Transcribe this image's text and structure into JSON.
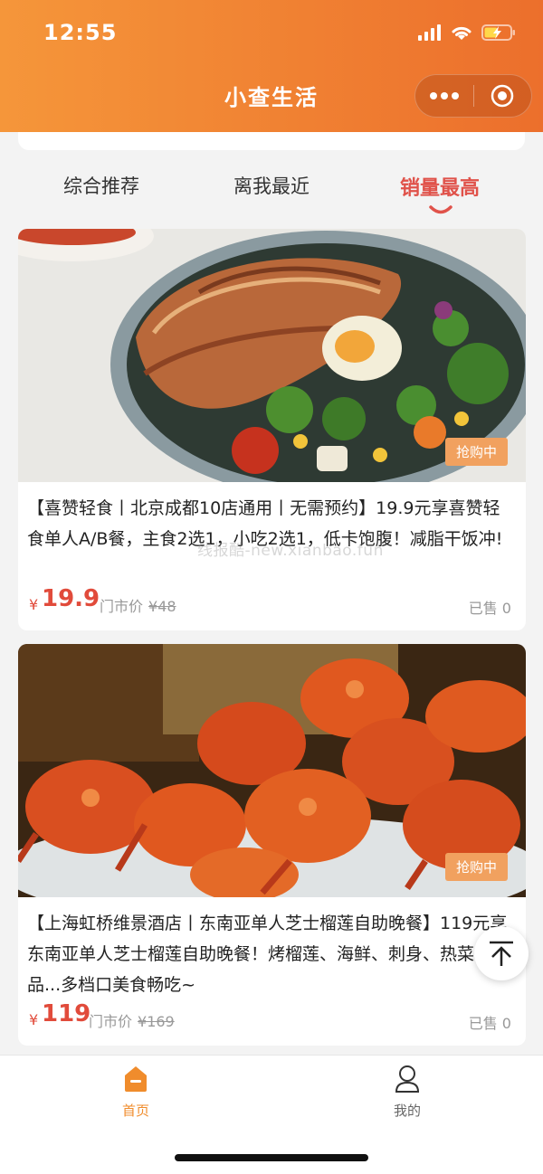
{
  "status": {
    "time": "12:55"
  },
  "header": {
    "title": "小查生活"
  },
  "tabs": [
    {
      "label": "综合推荐",
      "active": false
    },
    {
      "label": "离我最近",
      "active": false
    },
    {
      "label": "销量最高",
      "active": true
    }
  ],
  "products": [
    {
      "badge": "抢购中",
      "title": "【喜赞轻食丨北京成都10店通用丨无需预约】19.9元享喜赞轻食单人A/B餐，主食2选1，小吃2选1，低卡饱腹！减脂干饭冲!",
      "price_symbol": "¥",
      "price": "19.9",
      "market_label": "门市价",
      "market_price": "¥48",
      "sold_label": "已售 0",
      "image_icon": "salad-bowl-photo"
    },
    {
      "badge": "抢购中",
      "title": "【上海虹桥维景酒店丨东南亚单人芝士榴莲自助晚餐】119元享东南亚单人芝士榴莲自助晚餐！烤榴莲、海鲜、刺身、热菜、甜品...多档口美食畅吃~",
      "price_symbol": "¥",
      "price": "119",
      "market_label": "门市价",
      "market_price": "¥169",
      "sold_label": "已售 0",
      "image_icon": "crabs-on-ice-photo"
    }
  ],
  "watermark": "线报酷-new.xianbao.fun",
  "tabbar": [
    {
      "label": "首页",
      "icon": "home-icon",
      "active": true
    },
    {
      "label": "我的",
      "icon": "user-icon",
      "active": false
    }
  ],
  "colors": {
    "header_start": "#f5963a",
    "header_end": "#ec6f2c",
    "accent": "#e0524a",
    "price": "#e14b3b",
    "badge": "#f1a15f"
  }
}
